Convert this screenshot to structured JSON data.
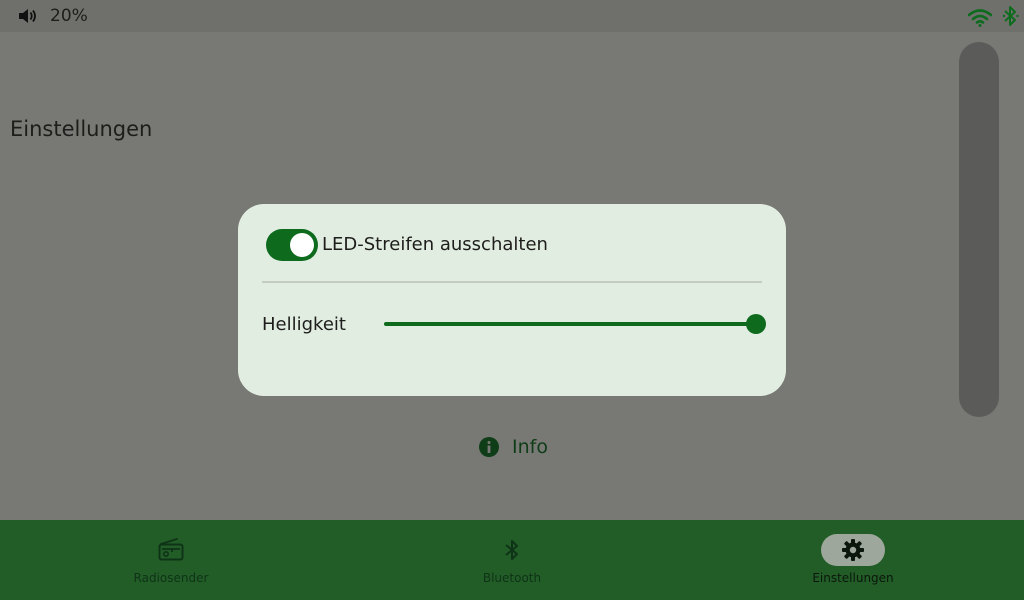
{
  "status_bar": {
    "volume_icon": "speaker-icon",
    "volume_text": "20%",
    "wifi_icon": "wifi-icon",
    "bluetooth_icon": "bluetooth-icon"
  },
  "page": {
    "title": "Einstellungen"
  },
  "dialog": {
    "toggle": {
      "label": "LED-Streifen ausschalten",
      "checked": true
    },
    "slider": {
      "label": "Helligkeit",
      "value_fraction": 1.0
    }
  },
  "info": {
    "label": "Info",
    "icon": "info-icon"
  },
  "bottom_nav": {
    "items": [
      {
        "label": "Radiosender",
        "icon": "radio-icon",
        "active": false
      },
      {
        "label": "Bluetooth",
        "icon": "bluetooth-icon",
        "active": false
      },
      {
        "label": "Einstellungen",
        "icon": "gear-icon",
        "active": true
      }
    ]
  },
  "colors": {
    "accent": "#0e6b1e",
    "nav_background": "#225d27",
    "dialog_background": "#e2ede1",
    "scrim": "#787874"
  }
}
